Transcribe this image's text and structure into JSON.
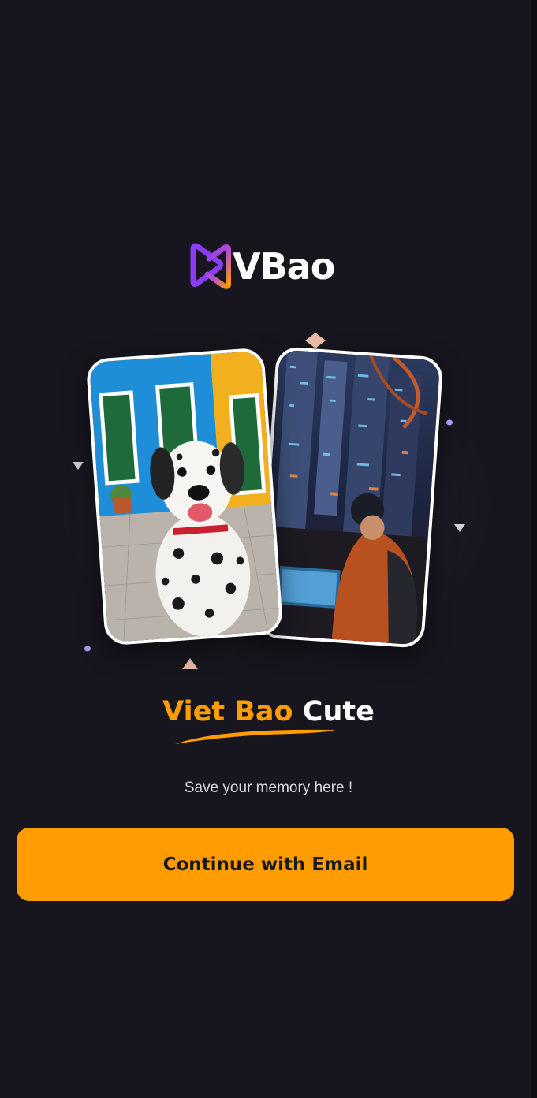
{
  "app": {
    "logo_text": "VBao",
    "logo_icon": "play-logo-icon"
  },
  "hero": {
    "headline_accent": "Viet Bao",
    "headline_plain": "Cute",
    "tagline": "Save your memory here !"
  },
  "actions": {
    "continue_email_label": "Continue with Email"
  },
  "colors": {
    "background": "#17161f",
    "accent": "#ff9d00",
    "logo_purple": "#8a3cf0",
    "logo_orange": "#ff9d00"
  }
}
